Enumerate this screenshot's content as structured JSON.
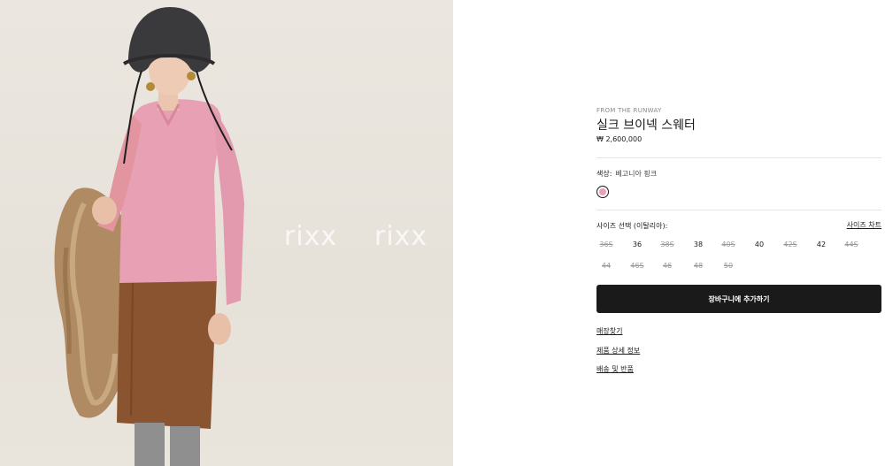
{
  "image": {
    "alt": "Model wearing pink silk V-neck sweater, brown skirt, black bucket hat, holding fur coat",
    "watermarks": [
      "rixx",
      "rixx"
    ]
  },
  "product": {
    "eyebrow": "FROM THE RUNWAY",
    "title": "실크 브이넥 스웨터",
    "price": "₩ 2,600,000"
  },
  "color": {
    "label": "색상:",
    "value": "베고니아 핑크",
    "swatch_hex": "#e8a0b4"
  },
  "size": {
    "label": "사이즈 선택 (이탈리아):",
    "chart_link": "사이즈 차트",
    "row1": [
      {
        "label": "36S",
        "available": false
      },
      {
        "label": "36",
        "available": true
      },
      {
        "label": "38S",
        "available": false
      },
      {
        "label": "38",
        "available": true
      },
      {
        "label": "40S",
        "available": false
      },
      {
        "label": "40",
        "available": true
      },
      {
        "label": "42S",
        "available": false
      },
      {
        "label": "42",
        "available": true
      },
      {
        "label": "44S",
        "available": false
      }
    ],
    "row2": [
      {
        "label": "44",
        "available": false
      },
      {
        "label": "46S",
        "available": false
      },
      {
        "label": "46",
        "available": false
      },
      {
        "label": "48",
        "available": false
      },
      {
        "label": "50",
        "available": false
      }
    ]
  },
  "actions": {
    "add_to_cart": "장바구니에 추가하기"
  },
  "links": {
    "store_finder": "매장찾기",
    "product_details": "제품 상세 정보",
    "shipping_returns": "배송 및 반품"
  }
}
